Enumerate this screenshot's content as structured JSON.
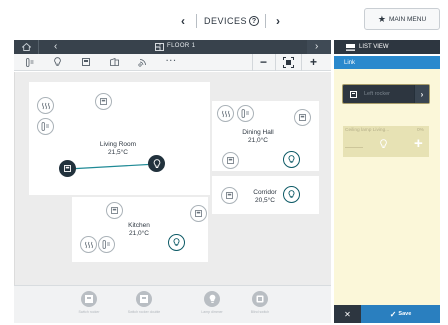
{
  "topbar": {
    "prev_arrow": "‹",
    "title": "DEVICES",
    "help_glyph": "?",
    "next_arrow": "›",
    "main_menu_label": "MAIN MENU",
    "main_menu_icon": "star-icon"
  },
  "floor_panel": {
    "home_icon": "home-icon",
    "prev_arrow": "‹",
    "floor_icon": "floorplan-icon",
    "floor_label": "FLOOR 1",
    "next_arrow": "›",
    "toolbar": {
      "tools": [
        "thermostat-icon",
        "bulb-icon",
        "switch-icon",
        "blind-icon",
        "remote-icon",
        "more-icon"
      ],
      "more_label": "···",
      "zoom_out": "−",
      "fit": "fit-icon",
      "zoom_in": "+"
    }
  },
  "rooms": [
    {
      "name": "Living Room",
      "temp": "21,5°C"
    },
    {
      "name": "Dining Hall",
      "temp": "21,0°C"
    },
    {
      "name": "Corridor",
      "temp": "20,5°C"
    },
    {
      "name": "Kitchen",
      "temp": "21,0°C"
    }
  ],
  "tray": {
    "items": [
      {
        "icon": "switch-icon",
        "label": "Switch rocker"
      },
      {
        "icon": "switch-icon",
        "label": "Switch rocker double"
      },
      {
        "icon": "bulb-icon",
        "label": "Lamp dimmer"
      },
      {
        "icon": "blind-icon",
        "label": "Blind switch"
      }
    ]
  },
  "side_panel": {
    "header_icon": "list-icon",
    "header_label": "LIST VIEW",
    "tab_label": "Link",
    "rocker": {
      "label": "Left rocker",
      "arrow": "›"
    },
    "lamp": {
      "name": "Ceiling lamp Living...",
      "percent": "0%",
      "add": "+"
    },
    "cancel_label": "✕",
    "save_label": "Save",
    "save_check": "✓"
  },
  "colors": {
    "dark": "#2d3640",
    "accent_blue": "#2a89cd",
    "link_line": "#1f8a96",
    "panel_yellow": "#fbf7d9"
  }
}
